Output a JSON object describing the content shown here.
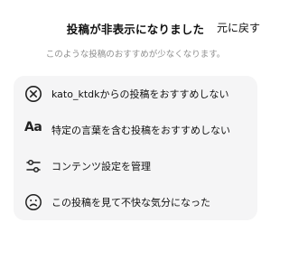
{
  "header": {
    "title": "投稿が非表示になりました",
    "undo_label": "元に戻す"
  },
  "subtitle": "このような投稿のおすすめが少なくなります。",
  "menu": {
    "items": [
      {
        "icon": "x-circle-icon",
        "label": "kato_ktdkからの投稿をおすすめしない"
      },
      {
        "icon": "text-aa-icon",
        "icon_text": "Aa",
        "label": "特定の言葉を含む投稿をおすすめしない"
      },
      {
        "icon": "sliders-icon",
        "label": "コンテンツ設定を管理"
      },
      {
        "icon": "sad-face-icon",
        "label": "この投稿を見て不快な気分になった"
      }
    ]
  },
  "colors": {
    "menu_background": "#f5f5f6",
    "subtitle_text": "#8e8e8e",
    "primary_text": "#111111"
  }
}
